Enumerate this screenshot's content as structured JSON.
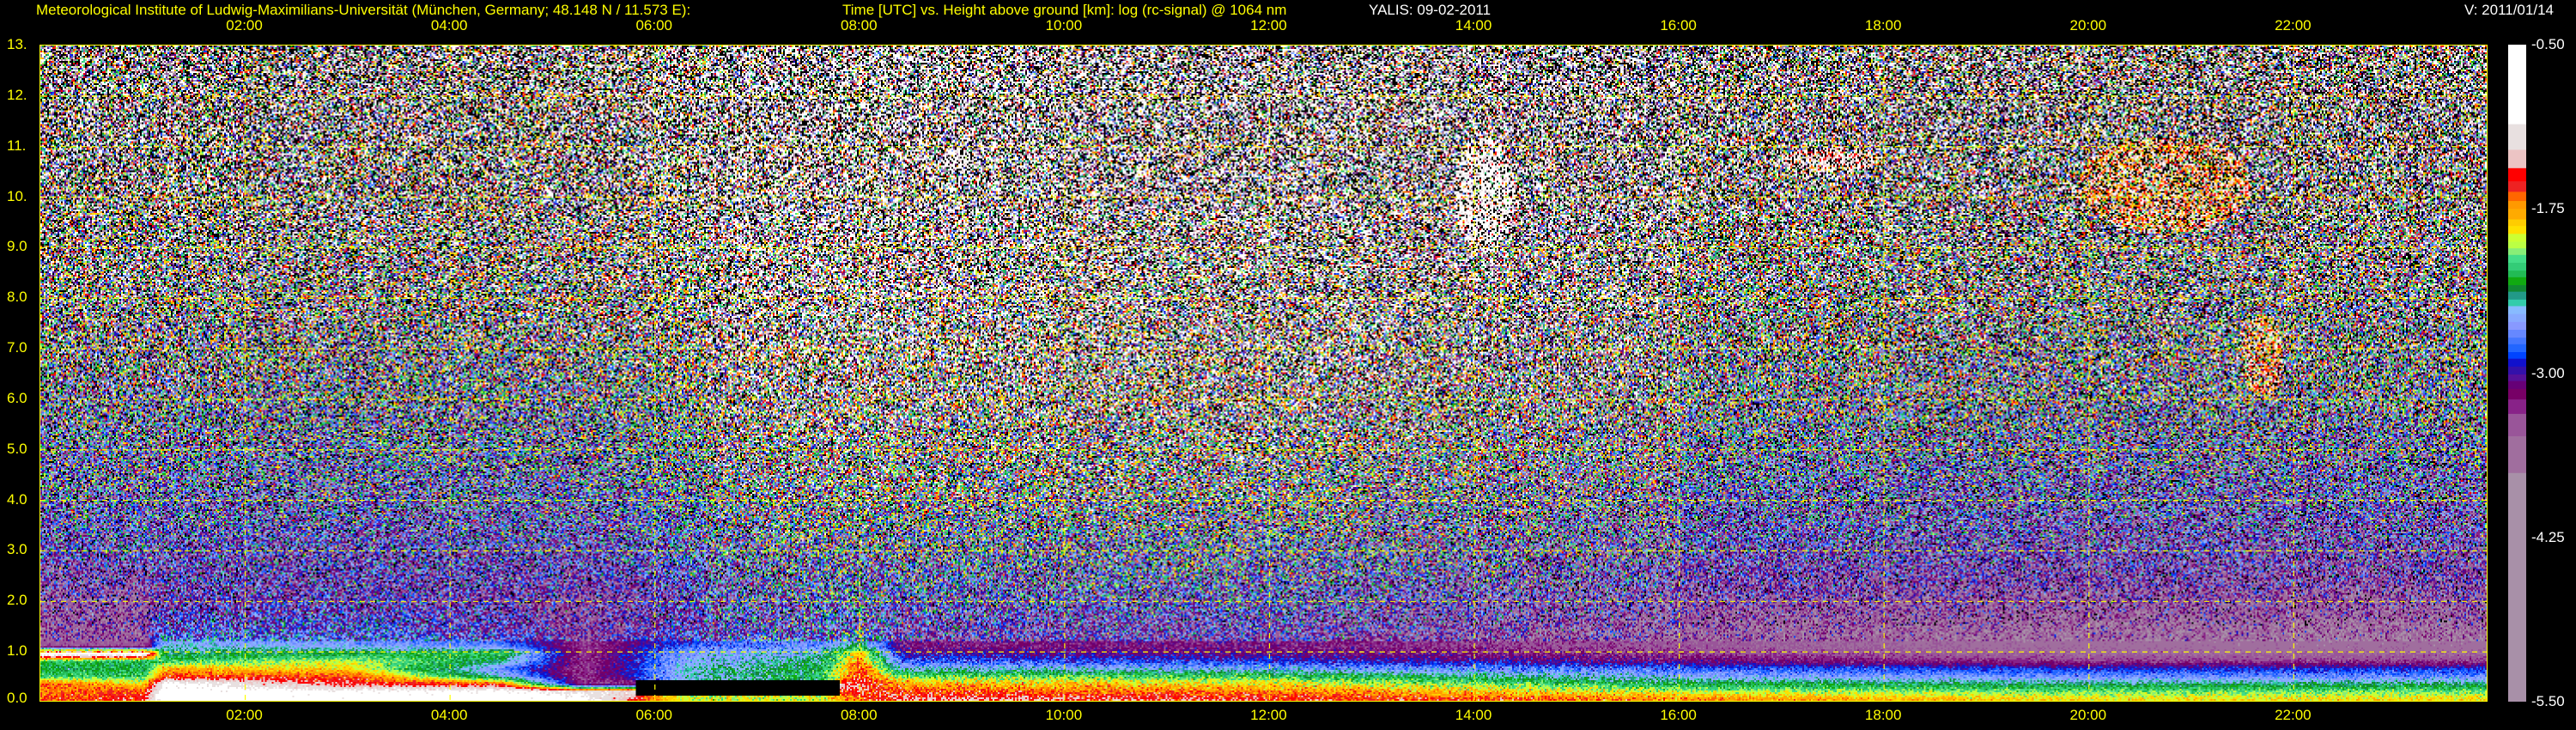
{
  "header": {
    "institute": "Meteorological Institute of Ludwig-Maximilians-Universität (München, Germany; 48.148 N / 11.573 E):",
    "plot_description": "Time [UTC] vs. Height above ground [km]: log (rc-signal) @ 1064 nm",
    "instrument_date": "YALIS: 09-02-2011",
    "version": "V: 2011/01/14"
  },
  "chart_data": {
    "type": "heatmap",
    "title": "Time [UTC] vs. Height above ground [km]: log (rc-signal) @ 1064 nm",
    "xlabel": "Time [UTC]",
    "ylabel": "Height above ground [km]",
    "xlim": [
      0,
      23.9
    ],
    "ylim": [
      0,
      13
    ],
    "grid": true,
    "x_ticks": [
      {
        "value": 2,
        "label": "02:00"
      },
      {
        "value": 4,
        "label": "04:00"
      },
      {
        "value": 6,
        "label": "06:00"
      },
      {
        "value": 8,
        "label": "08:00"
      },
      {
        "value": 10,
        "label": "10:00"
      },
      {
        "value": 12,
        "label": "12:00"
      },
      {
        "value": 14,
        "label": "14:00"
      },
      {
        "value": 16,
        "label": "16:00"
      },
      {
        "value": 18,
        "label": "18:00"
      },
      {
        "value": 20,
        "label": "20:00"
      },
      {
        "value": 22,
        "label": "22:00"
      }
    ],
    "y_ticks": [
      {
        "value": 13,
        "label": "13."
      },
      {
        "value": 12,
        "label": "12."
      },
      {
        "value": 11,
        "label": "11."
      },
      {
        "value": 10,
        "label": "10."
      },
      {
        "value": 9,
        "label": "9.0"
      },
      {
        "value": 8,
        "label": "8.0"
      },
      {
        "value": 7,
        "label": "7.0"
      },
      {
        "value": 6,
        "label": "6.0"
      },
      {
        "value": 5,
        "label": "5.0"
      },
      {
        "value": 4,
        "label": "4.0"
      },
      {
        "value": 3,
        "label": "3.0"
      },
      {
        "value": 2,
        "label": "2.0"
      },
      {
        "value": 1,
        "label": "1.0"
      },
      {
        "value": 0,
        "label": "0.0"
      }
    ],
    "colorbar": {
      "range": [
        -5.5,
        -0.5
      ],
      "ticks": [
        {
          "value": -0.5,
          "label": "-0.50"
        },
        {
          "value": -1.75,
          "label": "-1.75"
        },
        {
          "value": -3.0,
          "label": "-3.00"
        },
        {
          "value": -4.25,
          "label": "-4.25"
        },
        {
          "value": -5.5,
          "label": "-5.50"
        }
      ],
      "bounds": [
        -0.5,
        -1.105,
        -1.3,
        -1.44,
        -1.54,
        -1.62,
        -1.69,
        -1.75,
        -1.83,
        -1.88,
        -1.94,
        -2.0,
        -2.05,
        -2.1,
        -2.16,
        -2.22,
        -2.27,
        -2.33,
        -2.38,
        -2.44,
        -2.49,
        -2.55,
        -2.61,
        -2.67,
        -2.73,
        -2.78,
        -2.84,
        -2.89,
        -2.95,
        -3.01,
        -3.06,
        -3.12,
        -3.2,
        -3.31,
        -3.48,
        -3.76,
        -5.5
      ],
      "colors": [
        "#ffffff",
        "#e8e0e0",
        "#ecc4c4",
        "#ff0000",
        "#ee2222",
        "#ff6600",
        "#ff9900",
        "#ffaa00",
        "#ffcc00",
        "#ffe000",
        "#ccff33",
        "#bbff44",
        "#88ee77",
        "#44dd88",
        "#33cc77",
        "#22bb55",
        "#11aa11",
        "#118833",
        "#229988",
        "#33ccaa",
        "#88bbff",
        "#88aaff",
        "#8899ff",
        "#6688ff",
        "#4477ff",
        "#2266ff",
        "#0044ff",
        "#1111cc",
        "#3311aa",
        "#551199",
        "#660077",
        "#770066",
        "#882288",
        "#995599",
        "#a06e9e",
        "#a890a8"
      ]
    },
    "profile_heights_km": [
      0.05,
      0.2,
      0.35,
      0.5,
      0.65,
      0.8,
      0.95,
      1.1,
      1.4,
      2.0,
      3.0,
      4.5,
      6.0,
      8.0,
      10.0,
      12.5
    ],
    "profiles": [
      {
        "time": 0.0,
        "values": [
          -1.6,
          -1.7,
          -1.6,
          -2.2,
          -2.3,
          -2.2,
          -0.8,
          -3.4,
          -3.4,
          -3.4,
          -3.0,
          -2.8,
          -2.6,
          -2.3,
          -2.1,
          -2.0
        ]
      },
      {
        "time": 1.0,
        "values": [
          -1.5,
          -1.6,
          -1.9,
          -2.2,
          -2.3,
          -2.3,
          -0.8,
          -3.4,
          -3.4,
          -3.4,
          -3.0,
          -2.8,
          -2.6,
          -2.3,
          -2.1,
          -2.0
        ]
      },
      {
        "time": 1.2,
        "values": [
          -0.9,
          -0.9,
          -1.0,
          -1.6,
          -1.8,
          -2.2,
          -2.4,
          -2.5,
          -2.8,
          -3.1,
          -3.0,
          -2.8,
          -2.6,
          -2.3,
          -2.1,
          -2.0
        ]
      },
      {
        "time": 3.0,
        "values": [
          -0.9,
          -1.0,
          -1.5,
          -1.6,
          -1.9,
          -2.0,
          -2.3,
          -2.6,
          -2.8,
          -3.0,
          -3.0,
          -2.8,
          -2.6,
          -2.3,
          -2.1,
          -2.0
        ]
      },
      {
        "time": 4.5,
        "values": [
          -0.9,
          -1.0,
          -1.6,
          -2.5,
          -2.7,
          -2.4,
          -2.2,
          -2.7,
          -3.0,
          -3.1,
          -3.0,
          -2.8,
          -2.6,
          -2.3,
          -2.1,
          -2.0
        ]
      },
      {
        "time": 5.3,
        "values": [
          -1.0,
          -1.2,
          -3.3,
          -3.3,
          -3.3,
          -3.3,
          -3.3,
          -3.3,
          -3.3,
          -3.3,
          -3.0,
          -2.8,
          -2.5,
          -2.2,
          -2.0,
          -1.9
        ]
      },
      {
        "time": 6.3,
        "values": [
          -2.0,
          -6.0,
          -6.0,
          -2.5,
          -2.5,
          -2.6,
          -2.6,
          -2.8,
          -3.0,
          -3.0,
          -2.8,
          -2.6,
          -2.3,
          -2.0,
          -1.8,
          -1.6
        ]
      },
      {
        "time": 7.6,
        "values": [
          -2.0,
          -6.0,
          -6.0,
          -2.3,
          -2.3,
          -2.4,
          -2.5,
          -2.7,
          -2.8,
          -2.8,
          -2.6,
          -2.3,
          -2.0,
          -1.7,
          -1.5,
          -1.3
        ]
      },
      {
        "time": 8.0,
        "values": [
          -1.6,
          -1.5,
          -1.4,
          -1.5,
          -1.6,
          -1.7,
          -1.8,
          -2.3,
          -2.7,
          -2.8,
          -2.6,
          -2.3,
          -2.0,
          -1.7,
          -1.5,
          -1.3
        ]
      },
      {
        "time": 8.4,
        "values": [
          -1.4,
          -1.6,
          -1.8,
          -2.1,
          -2.5,
          -2.8,
          -3.0,
          -3.2,
          -3.1,
          -2.9,
          -2.7,
          -2.4,
          -2.1,
          -1.8,
          -1.6,
          -1.4
        ]
      },
      {
        "time": 12.0,
        "values": [
          -1.5,
          -1.7,
          -1.9,
          -2.2,
          -2.6,
          -2.9,
          -3.1,
          -3.2,
          -3.1,
          -2.9,
          -2.7,
          -2.4,
          -2.1,
          -1.9,
          -1.7,
          -1.6
        ]
      },
      {
        "time": 16.0,
        "values": [
          -1.7,
          -2.0,
          -2.3,
          -2.6,
          -2.8,
          -3.1,
          -3.3,
          -3.4,
          -3.5,
          -3.3,
          -3.0,
          -2.8,
          -2.5,
          -2.2,
          -2.0,
          -1.9
        ]
      },
      {
        "time": 20.0,
        "values": [
          -1.9,
          -2.1,
          -2.4,
          -2.7,
          -2.9,
          -3.3,
          -3.5,
          -3.6,
          -3.6,
          -3.4,
          -3.1,
          -2.9,
          -2.6,
          -2.4,
          -2.2,
          -2.0
        ]
      },
      {
        "time": 23.9,
        "values": [
          -1.9,
          -2.1,
          -2.4,
          -2.7,
          -2.9,
          -3.3,
          -3.5,
          -3.6,
          -3.6,
          -3.4,
          -3.1,
          -2.9,
          -2.6,
          -2.4,
          -2.2,
          -2.0
        ]
      }
    ],
    "clouds": [
      {
        "t_start": 8.8,
        "t_end": 9.1,
        "base_km": 10.5,
        "top_km": 11.0,
        "value": -0.8
      },
      {
        "t_start": 13.8,
        "t_end": 14.4,
        "base_km": 8.9,
        "top_km": 11.2,
        "value": -0.9
      },
      {
        "t_start": 17.0,
        "t_end": 18.0,
        "base_km": 10.5,
        "top_km": 11.0,
        "value": -1.2
      },
      {
        "t_start": 19.9,
        "t_end": 21.6,
        "base_km": 9.3,
        "top_km": 11.2,
        "value": -1.5
      },
      {
        "t_start": 21.5,
        "t_end": 21.9,
        "base_km": 6.0,
        "top_km": 7.7,
        "value": -1.5
      }
    ]
  }
}
